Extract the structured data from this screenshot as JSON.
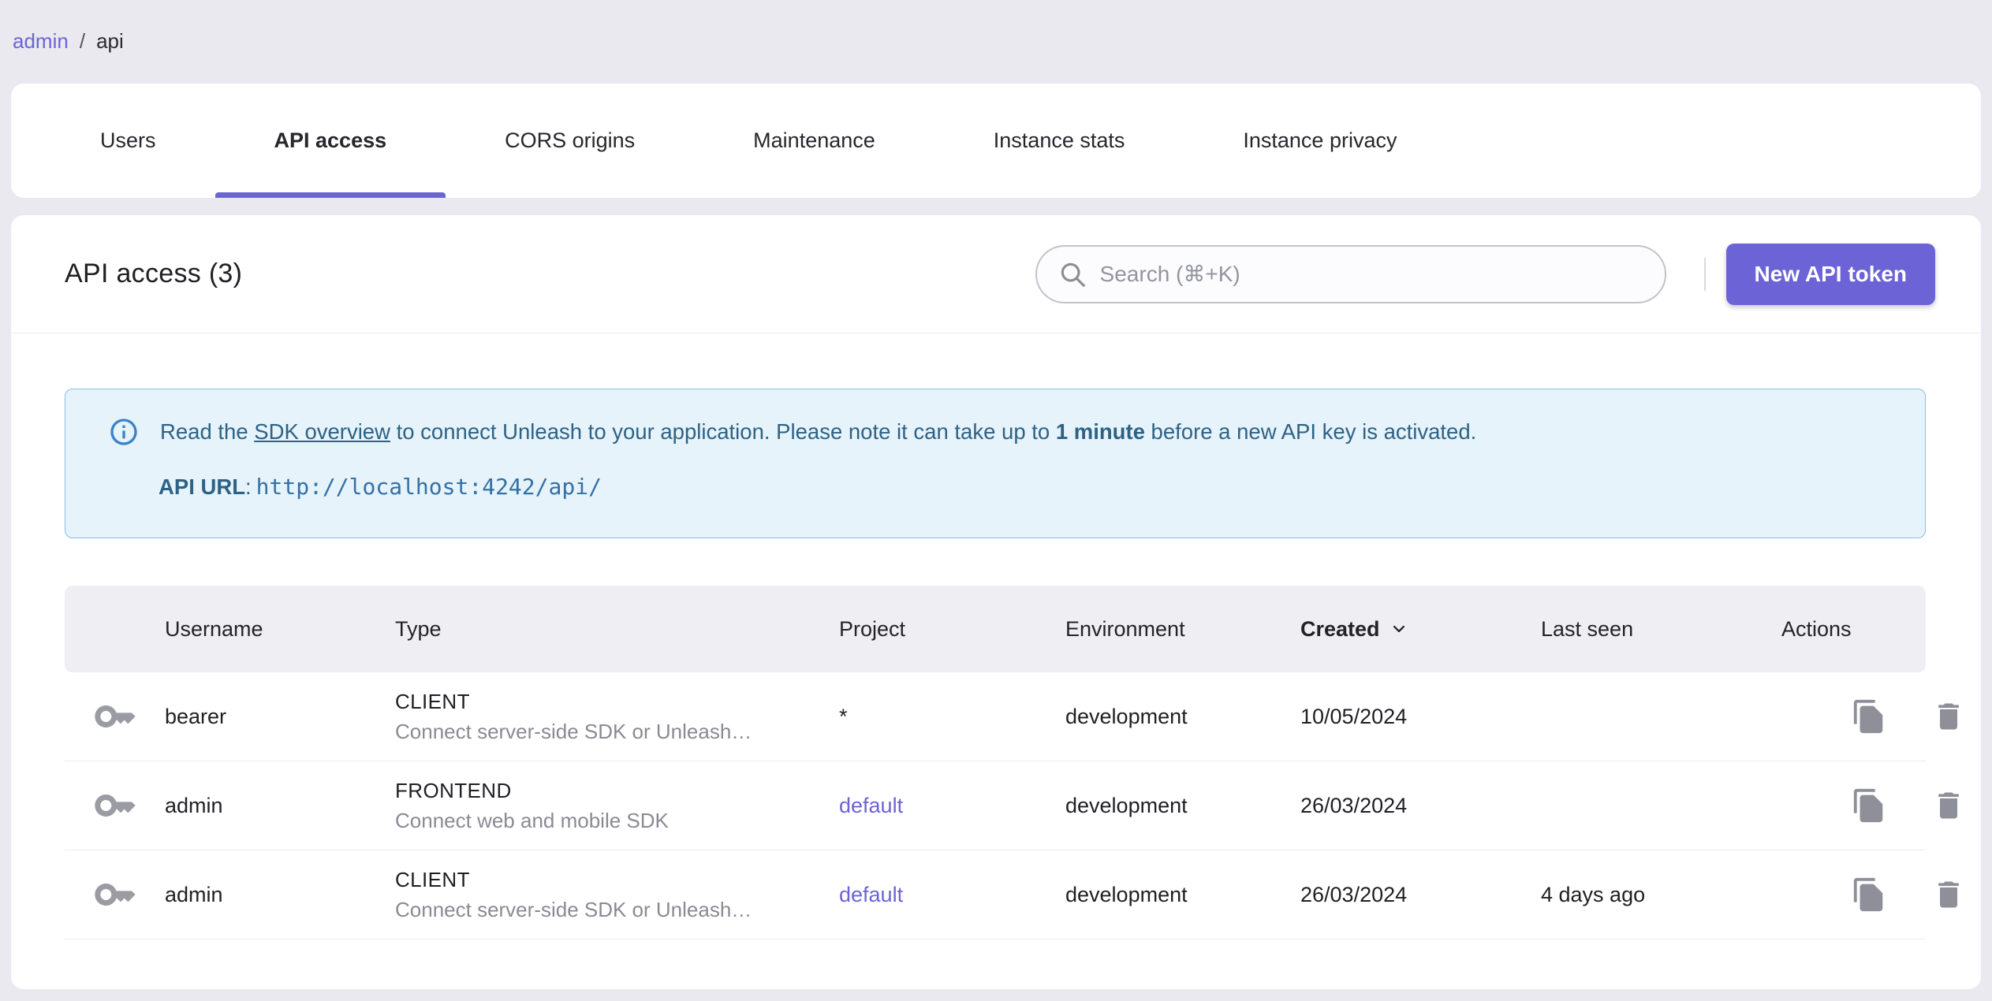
{
  "breadcrumb": {
    "parent": "admin",
    "separator": "/",
    "current": "api"
  },
  "tabs": [
    {
      "label": "Users",
      "active": false
    },
    {
      "label": "API access",
      "active": true
    },
    {
      "label": "CORS origins",
      "active": false
    },
    {
      "label": "Maintenance",
      "active": false
    },
    {
      "label": "Instance stats",
      "active": false
    },
    {
      "label": "Instance privacy",
      "active": false
    }
  ],
  "header": {
    "title": "API access (3)",
    "search_placeholder": "Search (⌘+K)",
    "new_token_button": "New API token"
  },
  "banner": {
    "read_prefix": "Read the ",
    "sdk_link": "SDK overview",
    "read_middle": " to connect Unleash to your application. Please note it can take up to ",
    "read_bold": "1 minute",
    "read_suffix": " before a new API key is activated.",
    "api_url_label": "API URL",
    "api_url_separator": ":",
    "api_url": "http://localhost:4242/api/"
  },
  "table": {
    "columns": [
      "Username",
      "Type",
      "Project",
      "Environment",
      "Created",
      "Last seen",
      "Actions"
    ],
    "sort": {
      "column": "Created",
      "direction": "desc"
    },
    "rows": [
      {
        "username": "bearer",
        "type": "CLIENT",
        "type_description": "Connect server-side SDK or Unleash…",
        "project": "*",
        "project_is_link": false,
        "environment": "development",
        "created": "10/05/2024",
        "last_seen": ""
      },
      {
        "username": "admin",
        "type": "FRONTEND",
        "type_description": "Connect web and mobile SDK",
        "project": "default",
        "project_is_link": true,
        "environment": "development",
        "created": "26/03/2024",
        "last_seen": ""
      },
      {
        "username": "admin",
        "type": "CLIENT",
        "type_description": "Connect server-side SDK or Unleash…",
        "project": "default",
        "project_is_link": true,
        "environment": "development",
        "created": "26/03/2024",
        "last_seen": "4 days ago"
      }
    ]
  },
  "colors": {
    "accent_purple": "#6c63d6",
    "page_background": "#eae9ef",
    "card_background": "#ffffff",
    "banner_background": "#e6f3fb",
    "banner_border": "#8cbedf",
    "banner_text": "#2e6284",
    "api_url_text": "#3470a6",
    "table_header_background": "#efeff3",
    "muted_text": "#8a8a94",
    "icon_grey": "#8f8f99"
  }
}
